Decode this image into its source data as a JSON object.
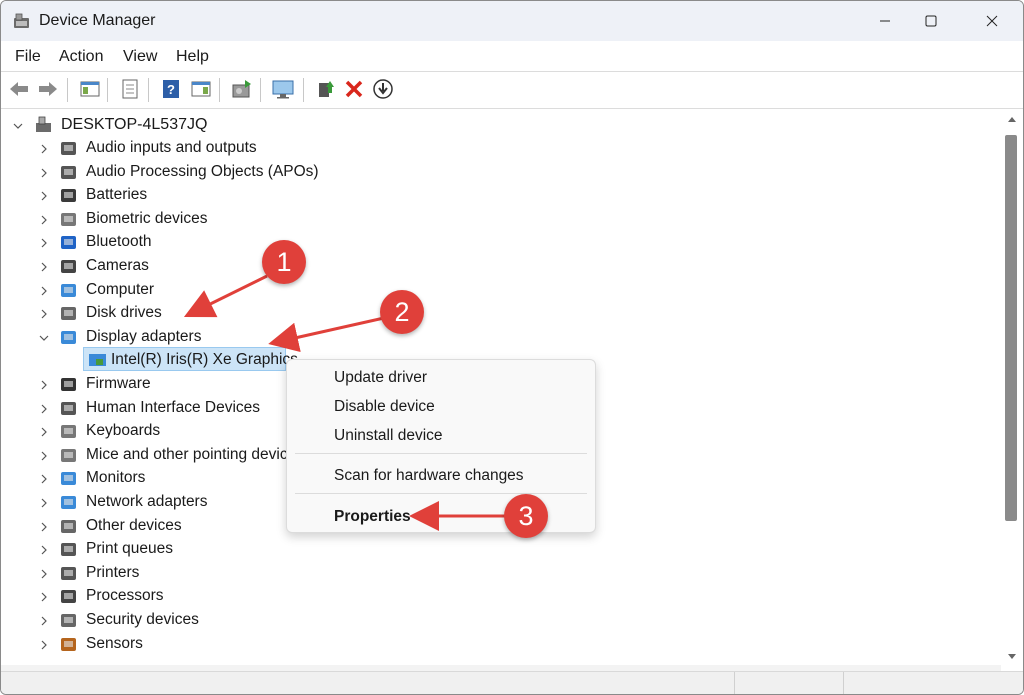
{
  "window": {
    "title": "Device Manager"
  },
  "menubar": {
    "items": [
      "File",
      "Action",
      "View",
      "Help"
    ]
  },
  "toolbar": {
    "icons": [
      "back-arrow-icon",
      "forward-arrow-icon",
      "show-hide-console-tree-icon",
      "properties-icon",
      "help-icon",
      "action-pane-icon",
      "scan-hardware-icon",
      "monitor-icon",
      "update-driver-icon",
      "uninstall-icon",
      "disable-device-icon"
    ]
  },
  "tree": {
    "root": "DESKTOP-4L537JQ",
    "categories": [
      "Audio inputs and outputs",
      "Audio Processing Objects (APOs)",
      "Batteries",
      "Biometric devices",
      "Bluetooth",
      "Cameras",
      "Computer",
      "Disk drives",
      "Display adapters",
      "Firmware",
      "Human Interface Devices",
      "Keyboards",
      "Mice and other pointing devices",
      "Monitors",
      "Network adapters",
      "Other devices",
      "Print queues",
      "Printers",
      "Processors",
      "Security devices",
      "Sensors"
    ],
    "expanded_child": "Intel(R) Iris(R) Xe Graphics"
  },
  "context_menu": {
    "items": [
      "Update driver",
      "Disable device",
      "Uninstall device",
      "Scan for hardware changes",
      "Properties"
    ]
  },
  "annotations": {
    "badges": [
      "1",
      "2",
      "3"
    ],
    "color": "#e0403a"
  },
  "colors": {
    "selection": "#cce4f7",
    "accent": "#e0403a",
    "titlebar": "#eef1f7"
  }
}
